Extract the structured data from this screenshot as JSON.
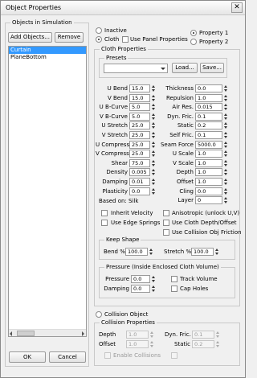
{
  "window": {
    "title": "Object Properties",
    "close_glyph": "✕"
  },
  "simulation": {
    "group_label": "Objects in Simulation",
    "add_label": "Add Objects...",
    "remove_label": "Remove",
    "objects": [
      "Curtain",
      "PlaneBottom"
    ],
    "selected_index": 0
  },
  "mode": {
    "inactive": "Inactive",
    "cloth": "Cloth",
    "use_panel": "Use Panel Properties",
    "property1": "Property 1",
    "property2": "Property 2",
    "selected": "cloth",
    "property_selected": "property1"
  },
  "cloth": {
    "group_label": "Cloth Properties",
    "presets_label": "Presets",
    "preset_value": "",
    "load_label": "Load...",
    "save_label": "Save...",
    "left_params": [
      {
        "label": "U Bend",
        "value": "15.0"
      },
      {
        "label": "V Bend",
        "value": "15.0"
      },
      {
        "label": "U B-Curve",
        "value": "5.0"
      },
      {
        "label": "V B-Curve",
        "value": "5.0"
      },
      {
        "label": "U Stretch",
        "value": "25.0"
      },
      {
        "label": "V Stretch",
        "value": "25.0"
      },
      {
        "label": "U Compress",
        "value": "25.0"
      },
      {
        "label": "V Compress",
        "value": "25.0"
      },
      {
        "label": "Shear",
        "value": "75.0"
      },
      {
        "label": "Density",
        "value": "0.005"
      },
      {
        "label": "Damping",
        "value": "0.01"
      },
      {
        "label": "Plasticity",
        "value": "0.0"
      }
    ],
    "right_params": [
      {
        "label": "Thickness",
        "value": "0.0"
      },
      {
        "label": "Repulsion",
        "value": "1.0"
      },
      {
        "label": "Air Res.",
        "value": "0.015"
      },
      {
        "label": "Dyn. Fric.",
        "value": "0.1"
      },
      {
        "label": "Static",
        "value": "0.2"
      },
      {
        "label": "Self Fric.",
        "value": "0.1"
      },
      {
        "label": "Seam Force",
        "value": "5000.0"
      },
      {
        "label": "U Scale",
        "value": "1.0"
      },
      {
        "label": "V Scale",
        "value": "1.0"
      },
      {
        "label": "Depth",
        "value": "1.0"
      },
      {
        "label": "Offset",
        "value": "1.0"
      },
      {
        "label": "Cling",
        "value": "0.0"
      },
      {
        "label": "Layer",
        "value": "0"
      }
    ],
    "based_on": "Based on: Silk",
    "checks": {
      "inherit_velocity": "Inherit Velocity",
      "use_edge_springs": "Use Edge Springs",
      "anisotropic": "Anisotropic (unlock U,V)",
      "use_cloth_depth": "Use Cloth Depth/Offset",
      "use_collision_friction": "Use Collision Obj Friction"
    }
  },
  "keep_shape": {
    "group_label": "Keep Shape",
    "bend_label": "Bend %",
    "bend_value": "100.0",
    "stretch_label": "Stretch %",
    "stretch_value": "100.0"
  },
  "pressure": {
    "group_label": "Pressure (Inside Enclosed Cloth Volume)",
    "pressure_label": "Pressure",
    "pressure_value": "0.0",
    "damping_label": "Damping",
    "damping_value": "0.0",
    "track_volume": "Track Volume",
    "cap_holes": "Cap Holes"
  },
  "collision": {
    "object_label": "Collision Object",
    "group_label": "Collision Properties",
    "depth_label": "Depth",
    "depth_value": "1.0",
    "offset_label": "Offset",
    "offset_value": "1.0",
    "dyn_fric_label": "Dyn. Fric.",
    "dyn_fric_value": "0.1",
    "static_label": "Static",
    "static_value": "0.2",
    "enable_collisions": "Enable Collisions"
  },
  "footer": {
    "ok_label": "OK",
    "cancel_label": "Cancel"
  },
  "colors": {
    "selection": "#3399ff",
    "window_bg": "#f0f0f0"
  }
}
